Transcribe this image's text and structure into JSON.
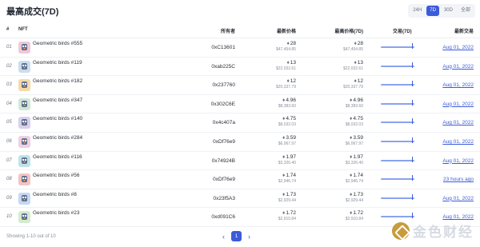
{
  "header": {
    "title": "最高成交(7D)",
    "tabs": [
      {
        "label": "24H",
        "active": false
      },
      {
        "label": "7D",
        "active": true
      },
      {
        "label": "30D",
        "active": false
      },
      {
        "label": "全部",
        "active": false
      }
    ]
  },
  "columns": {
    "index": "#",
    "nft": "NFT",
    "owner": "所有者",
    "price": "最新价格",
    "high": "最高价格(7D)",
    "volume": "交易(7D)",
    "last": "最新交易"
  },
  "rows": [
    {
      "idx": "01",
      "name": "Geometric birds #555",
      "owner": "0xC13601",
      "price": "28",
      "price_usd": "$47,454.85",
      "high": "28",
      "high_usd": "$47,454.85",
      "last": "Aug 01, 2022",
      "thumb_color": "#f0c9d8"
    },
    {
      "idx": "02",
      "name": "Geometric birds #119",
      "owner": "0xab225C",
      "price": "13",
      "price_usd": "$22,032.61",
      "high": "13",
      "high_usd": "$22,032.61",
      "last": "Aug 01, 2022",
      "thumb_color": "#c9dff0"
    },
    {
      "idx": "03",
      "name": "Geometric birds #182",
      "owner": "0x237760",
      "price": "12",
      "price_usd": "$20,337.79",
      "high": "12",
      "high_usd": "$20,337.79",
      "last": "Aug 01, 2022",
      "thumb_color": "#f5d9a8"
    },
    {
      "idx": "04",
      "name": "Geometric birds #347",
      "owner": "0x302C6E",
      "price": "4.96",
      "price_usd": "$8,383.60",
      "high": "4.96",
      "high_usd": "$8,383.60",
      "last": "Aug 01, 2022",
      "thumb_color": "#cfe8d5"
    },
    {
      "idx": "05",
      "name": "Geometric birds #140",
      "owner": "0x4c407a",
      "price": "4.75",
      "price_usd": "$8,032.03",
      "high": "4.75",
      "high_usd": "$8,032.03",
      "last": "Aug 01, 2022",
      "thumb_color": "#d8d0f0"
    },
    {
      "idx": "06",
      "name": "Geometric birds #284",
      "owner": "0xDf76e9",
      "price": "3.59",
      "price_usd": "$6,067.97",
      "high": "3.59",
      "high_usd": "$6,067.97",
      "last": "Aug 01, 2022",
      "thumb_color": "#f0d0e0"
    },
    {
      "idx": "07",
      "name": "Geometric birds #116",
      "owner": "0x74924B",
      "price": "1.97",
      "price_usd": "$3,326.40",
      "high": "1.97",
      "high_usd": "$3,326.40",
      "last": "Aug 01, 2022",
      "thumb_color": "#bfe3ea"
    },
    {
      "idx": "08",
      "name": "Geometric birds #56",
      "owner": "0xDf76e9",
      "price": "1.74",
      "price_usd": "$2,946.74",
      "high": "1.74",
      "high_usd": "$2,946.74",
      "last": "23 hours ago",
      "thumb_color": "#f2c4c4"
    },
    {
      "idx": "09",
      "name": "Geometric birds #8",
      "owner": "0x23f5A3",
      "price": "1.73",
      "price_usd": "$2,929.44",
      "high": "1.73",
      "high_usd": "$2,929.44",
      "last": "Aug 01, 2022",
      "thumb_color": "#c4d8f2"
    },
    {
      "idx": "10",
      "name": "Geometric birds #23",
      "owner": "0xd091C6",
      "price": "1.72",
      "price_usd": "$2,910.84",
      "high": "1.72",
      "high_usd": "$2,910.84",
      "last": "Aug 01, 2022",
      "thumb_color": "#d2ecd0"
    }
  ],
  "footer": {
    "info": "Showing 1-10 out of 10",
    "page": "1",
    "prev": "‹",
    "next": "›"
  },
  "watermark": {
    "text": "金色财经"
  },
  "colors": {
    "accent": "#3b5bdb",
    "bar": "#8aa2f0"
  }
}
